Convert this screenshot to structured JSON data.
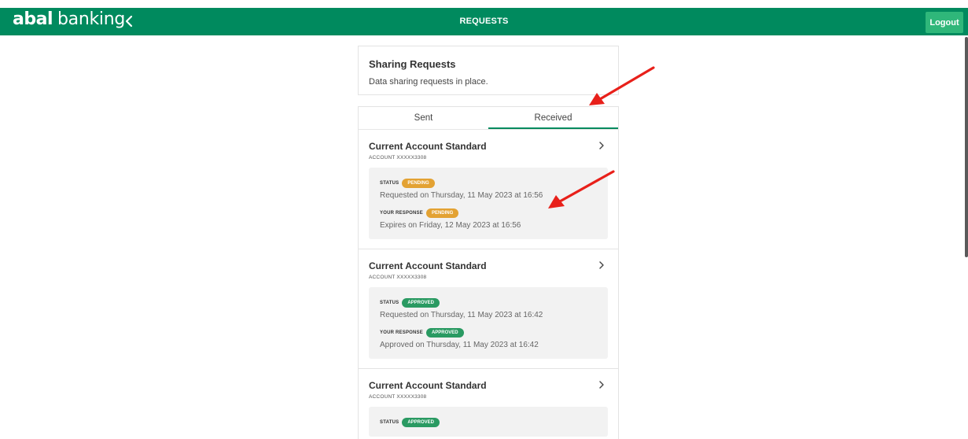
{
  "header": {
    "brand_bold": "abal",
    "brand_light": "banking",
    "page_title": "REQUESTS",
    "logout_label": "Logout"
  },
  "intro": {
    "title": "Sharing Requests",
    "subtitle": "Data sharing requests in place."
  },
  "tabs": [
    {
      "label": "Sent",
      "active": false
    },
    {
      "label": "Received",
      "active": true
    }
  ],
  "requests": [
    {
      "title": "Current Account Standard",
      "account": "ACCOUNT XXXXX3308",
      "status_label": "STATUS",
      "status_badge": "PENDING",
      "status_text": "Requested on Thursday, 11 May 2023 at 16:56",
      "response_label": "YOUR RESPONSE",
      "response_badge": "PENDING",
      "response_text": "Expires on Friday, 12 May 2023 at 16:56"
    },
    {
      "title": "Current Account Standard",
      "account": "ACCOUNT XXXXX3308",
      "status_label": "STATUS",
      "status_badge": "APPROVED",
      "status_text": "Requested on Thursday, 11 May 2023 at 16:42",
      "response_label": "YOUR RESPONSE",
      "response_badge": "APPROVED",
      "response_text": "Approved on Thursday, 11 May 2023 at 16:42"
    },
    {
      "title": "Current Account Standard",
      "account": "ACCOUNT XXXXX3308",
      "status_label": "STATUS",
      "status_badge": "APPROVED"
    }
  ],
  "colors": {
    "brand": "#008a5e",
    "logout": "#2fb77a",
    "pending": "#e3a233",
    "approved": "#2a9a62",
    "annotation_arrow": "#e8201a"
  },
  "icons": {
    "back": "chevron-left-icon",
    "row": "chevron-right-icon"
  }
}
